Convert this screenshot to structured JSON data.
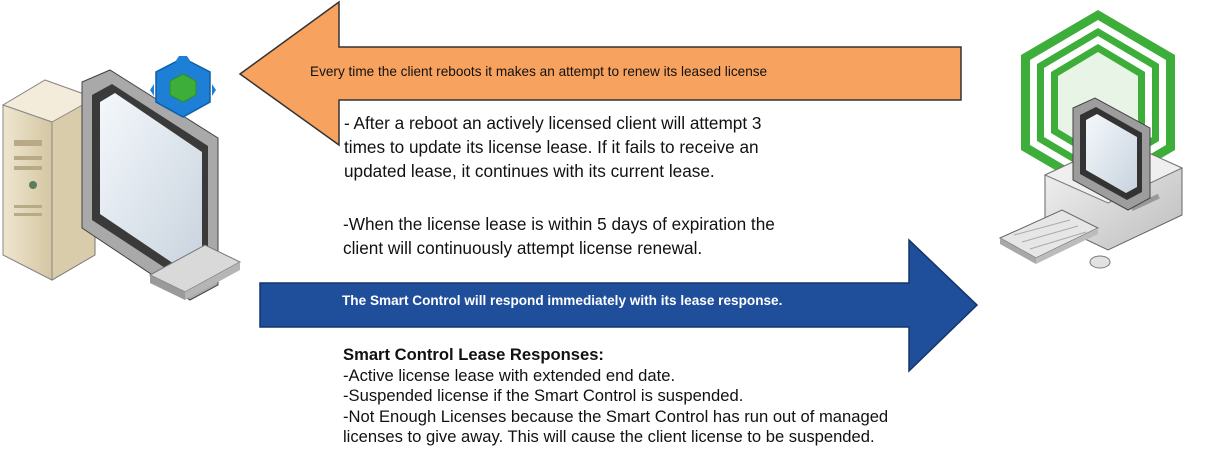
{
  "arrows": {
    "renew_label": "Every time the client reboots it makes an attempt to renew its leased license",
    "response_label": "The Smart Control will respond immediately with its lease response.",
    "renew_color": "#F7A25E",
    "response_color": "#1F4E9A"
  },
  "notes": {
    "reboot_attempts": [
      "- After a reboot an actively licensed client will attempt 3",
      "times to update its license lease. If it fails to receive an",
      "updated lease, it continues with its current lease."
    ],
    "expiration_renewal": [
      "-When the license lease is within 5 days of expiration the",
      "client will continuously attempt license renewal."
    ]
  },
  "responses": {
    "heading": "Smart Control Lease Responses:",
    "lines": [
      "-Active license lease with extended end date.",
      "-Suspended license if the Smart Control is suspended.",
      "-Not Enough Licenses because the Smart Control has run out of managed",
      "licenses to give away. This will cause the client license to be suspended."
    ]
  },
  "icons": {
    "client": "desktop-computer-icon",
    "client_badge": "blue-hexagon-icon",
    "server": "server-computer-icon",
    "server_badge": "green-hexagon-rings-icon"
  },
  "colors": {
    "badge_blue": "#1E7FD6",
    "badge_green": "#3DAE3A"
  }
}
